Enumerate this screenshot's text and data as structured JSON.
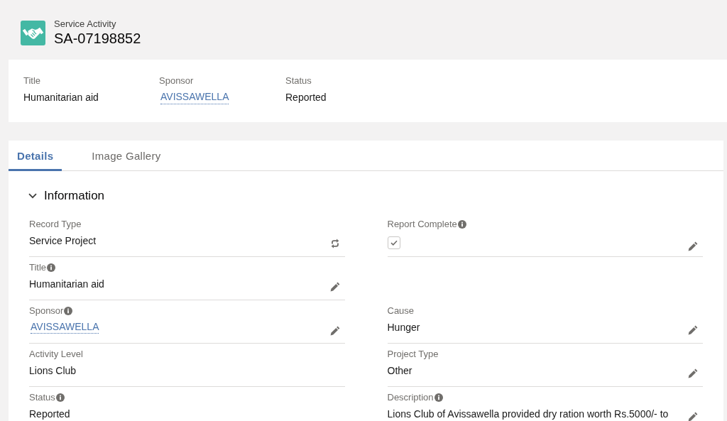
{
  "header": {
    "object_type": "Service Activity",
    "record_name": "SA-07198852"
  },
  "highlights": [
    {
      "label": "Title",
      "kind": "text",
      "value": "Humanitarian aid"
    },
    {
      "label": "Sponsor",
      "kind": "link",
      "value": "AVISSAWELLA"
    },
    {
      "label": "Status",
      "kind": "text",
      "value": "Reported"
    }
  ],
  "tabs": [
    {
      "label": "Details",
      "selected": true
    },
    {
      "label": "Image Gallery",
      "selected": false
    }
  ],
  "section": {
    "title": "Information",
    "expanded": true,
    "rows": [
      {
        "left": {
          "label": "Record Type",
          "info": false,
          "kind": "text",
          "value": "Service Project",
          "action": {
            "kind": "change_type"
          }
        },
        "right": {
          "label": "Report Complete",
          "info": true,
          "kind": "checkbox",
          "checked": true,
          "action": {
            "kind": "edit"
          }
        }
      },
      {
        "left": {
          "label": "Title",
          "info": true,
          "kind": "text",
          "value": "Humanitarian aid",
          "action": {
            "kind": "edit"
          }
        }
      },
      {
        "left": {
          "label": "Sponsor",
          "info": true,
          "kind": "link",
          "value": "AVISSAWELLA",
          "action": {
            "kind": "edit"
          }
        },
        "right": {
          "label": "Cause",
          "info": false,
          "kind": "text",
          "value": "Hunger",
          "action": {
            "kind": "edit"
          }
        }
      },
      {
        "left": {
          "label": "Activity Level",
          "info": false,
          "kind": "text",
          "value": "Lions Club"
        },
        "right": {
          "label": "Project Type",
          "info": false,
          "kind": "text",
          "value": "Other",
          "action": {
            "kind": "edit"
          }
        }
      },
      {
        "left": {
          "label": "Status",
          "info": true,
          "kind": "text",
          "value": "Reported"
        },
        "right": {
          "label": "Description",
          "info": true,
          "kind": "text",
          "value": "Lions Club of Avissawella provided dry ration worth Rs.5000/- to",
          "action": {
            "kind": "edit"
          }
        }
      }
    ]
  }
}
